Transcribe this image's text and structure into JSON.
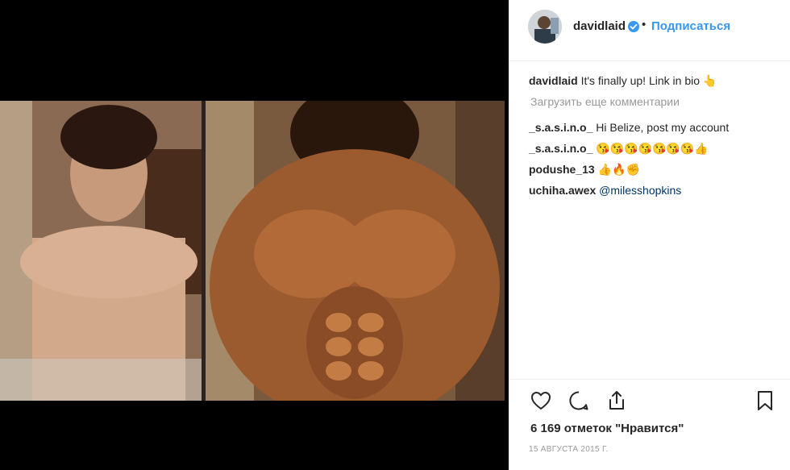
{
  "header": {
    "username": "davidlaid",
    "separator": "•",
    "follow_label": "Подписаться"
  },
  "caption": {
    "username": "davidlaid",
    "text": "It's finally up! Link in bio 👆"
  },
  "load_more_label": "Загрузить еще комментарии",
  "comments": [
    {
      "username": "_s.a.s.i.n.o_",
      "text": "Hi Belize, post my account",
      "mention": ""
    },
    {
      "username": "_s.a.s.i.n.o_",
      "text": "😘😘😘😘😘😘😘👍",
      "mention": ""
    },
    {
      "username": "podushe_13",
      "text": "👍🔥✊",
      "mention": ""
    },
    {
      "username": "uchiha.awex",
      "text": "",
      "mention": "@milesshopkins"
    }
  ],
  "likes_label": "6 169 отметок \"Нравится\"",
  "date_label": "15 АВГУСТА 2015 Г.",
  "colors": {
    "accent": "#3897f0",
    "text": "#262626",
    "muted": "#999999",
    "mention": "#003569"
  },
  "icons": [
    "heart-icon",
    "comment-icon",
    "share-icon",
    "bookmark-icon",
    "verified-icon"
  ]
}
